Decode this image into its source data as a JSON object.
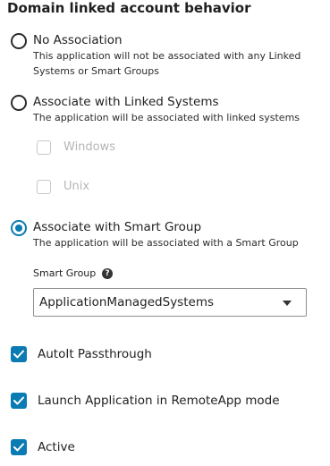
{
  "title": "Domain linked account behavior",
  "options": [
    {
      "label": "No Association",
      "description": "This application will not be associated with any Linked Systems or Smart Groups",
      "selected": false
    },
    {
      "label": "Associate with Linked Systems",
      "description": "The application will be associated with linked systems",
      "selected": false
    },
    {
      "label": "Associate with Smart Group",
      "description": "The application will be associated with a Smart Group",
      "selected": true
    }
  ],
  "linked_systems": [
    {
      "label": "Windows",
      "checked": false,
      "disabled": true
    },
    {
      "label": "Unix",
      "checked": false,
      "disabled": true
    }
  ],
  "smart_group": {
    "label": "Smart Group",
    "help_icon": "question-circle-icon",
    "help_glyph": "?",
    "value": "ApplicationManagedSystems"
  },
  "checkboxes": [
    {
      "label": "AutoIt Passthrough",
      "checked": true
    },
    {
      "label": "Launch Application in RemoteApp mode",
      "checked": true
    },
    {
      "label": "Active",
      "checked": true
    }
  ],
  "colors": {
    "accent": "#0a7bb3",
    "disabled": "#c8c8c8",
    "text": "#222222"
  }
}
